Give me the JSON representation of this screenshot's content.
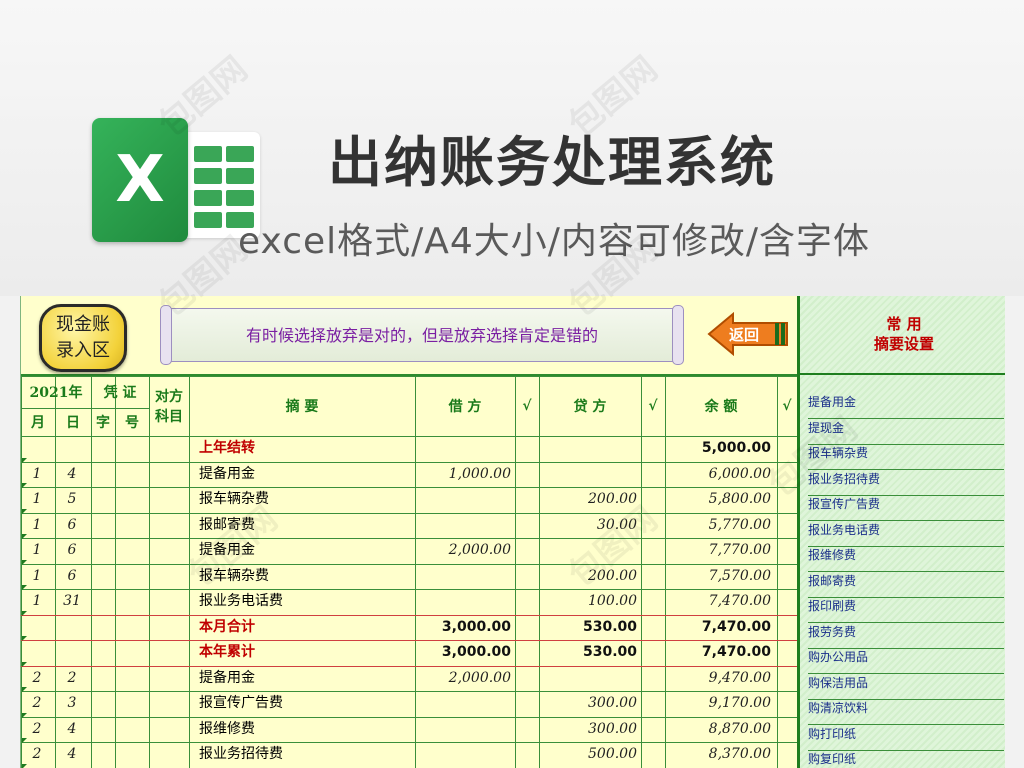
{
  "promo": {
    "title": "出纳账务处理系统",
    "subtitle": "excel格式/A4大小/内容可修改/含字体",
    "logo_letter": "X"
  },
  "sheet": {
    "cash_button": "现金账\n录入区",
    "motto": "有时候选择放弃是对的，但是放弃选择肯定是错的",
    "back_button": "返回",
    "headers": {
      "year": "2021年",
      "voucher": "凭  证",
      "counter_account": "对方\n科目",
      "summary": "摘      要",
      "debit": "借    方",
      "credit": "贷    方",
      "balance": "余    额",
      "check": "√",
      "month": "月",
      "day": "日",
      "word": "字",
      "number": "号"
    },
    "rows": [
      {
        "m": "",
        "d": "",
        "summary": "上年结转",
        "debit": "",
        "credit": "",
        "balance": "5,000.00",
        "kind": "sum"
      },
      {
        "m": "1",
        "d": "4",
        "summary": "提备用金",
        "debit": "1,000.00",
        "credit": "",
        "balance": "6,000.00",
        "kind": "normal"
      },
      {
        "m": "1",
        "d": "5",
        "summary": "报车辆杂费",
        "debit": "",
        "credit": "200.00",
        "balance": "5,800.00",
        "kind": "normal"
      },
      {
        "m": "1",
        "d": "6",
        "summary": "报邮寄费",
        "debit": "",
        "credit": "30.00",
        "balance": "5,770.00",
        "kind": "normal"
      },
      {
        "m": "1",
        "d": "6",
        "summary": "提备用金",
        "debit": "2,000.00",
        "credit": "",
        "balance": "7,770.00",
        "kind": "normal"
      },
      {
        "m": "1",
        "d": "6",
        "summary": "报车辆杂费",
        "debit": "",
        "credit": "200.00",
        "balance": "7,570.00",
        "kind": "normal"
      },
      {
        "m": "1",
        "d": "31",
        "summary": "报业务电话费",
        "debit": "",
        "credit": "100.00",
        "balance": "7,470.00",
        "kind": "normal"
      },
      {
        "m": "",
        "d": "",
        "summary": "本月合计",
        "debit": "3,000.00",
        "credit": "530.00",
        "balance": "7,470.00",
        "kind": "total"
      },
      {
        "m": "",
        "d": "",
        "summary": "本年累计",
        "debit": "3,000.00",
        "credit": "530.00",
        "balance": "7,470.00",
        "kind": "total"
      },
      {
        "m": "2",
        "d": "2",
        "summary": "提备用金",
        "debit": "2,000.00",
        "credit": "",
        "balance": "9,470.00",
        "kind": "normal"
      },
      {
        "m": "2",
        "d": "3",
        "summary": "报宣传广告费",
        "debit": "",
        "credit": "300.00",
        "balance": "9,170.00",
        "kind": "normal"
      },
      {
        "m": "2",
        "d": "4",
        "summary": "报维修费",
        "debit": "",
        "credit": "300.00",
        "balance": "8,870.00",
        "kind": "normal"
      },
      {
        "m": "2",
        "d": "4",
        "summary": "报业务招待费",
        "debit": "",
        "credit": "500.00",
        "balance": "8,370.00",
        "kind": "normal"
      }
    ]
  },
  "panel": {
    "title_line1": "常  用",
    "title_line2": "摘要设置",
    "presets": [
      "提备用金",
      "提现金",
      "报车辆杂费",
      "报业务招待费",
      "报宣传广告费",
      "报业务电话费",
      "报维修费",
      "报邮寄费",
      "报印刷费",
      "报劳务费",
      "购办公用品",
      "购保洁用品",
      "购清凉饮料",
      "购打印纸",
      "购复印纸"
    ]
  },
  "colors": {
    "sheet_bg": "#ffffcc",
    "grid_line": "#3a8f3a",
    "header_text": "#1a7a1a",
    "total_text": "#c00000",
    "panel_text": "#1a2f8a",
    "motto_text": "#7a1fa2",
    "excel_green": "#1f8a3d"
  },
  "icons": [
    "excel-logo-icon",
    "back-arrow-icon"
  ]
}
